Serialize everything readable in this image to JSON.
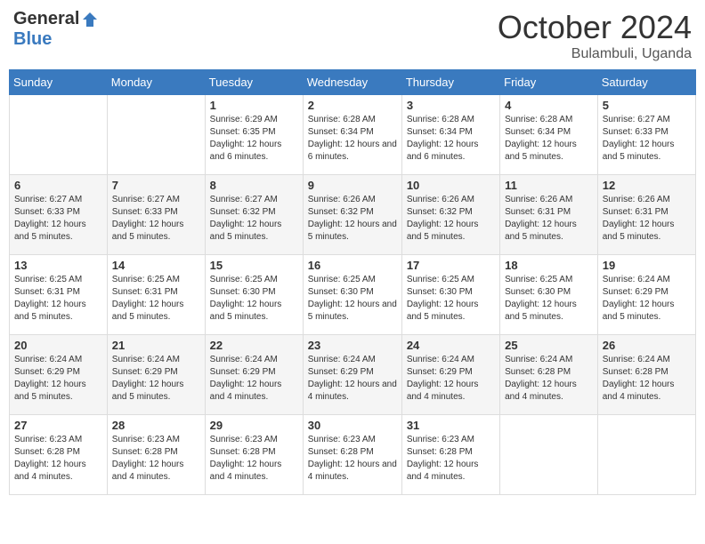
{
  "header": {
    "logo_general": "General",
    "logo_blue": "Blue",
    "month_title": "October 2024",
    "location": "Bulambuli, Uganda"
  },
  "days_of_week": [
    "Sunday",
    "Monday",
    "Tuesday",
    "Wednesday",
    "Thursday",
    "Friday",
    "Saturday"
  ],
  "weeks": [
    [
      {
        "day": "",
        "sunrise": "",
        "sunset": "",
        "daylight": ""
      },
      {
        "day": "",
        "sunrise": "",
        "sunset": "",
        "daylight": ""
      },
      {
        "day": "1",
        "sunrise": "Sunrise: 6:29 AM",
        "sunset": "Sunset: 6:35 PM",
        "daylight": "Daylight: 12 hours and 6 minutes."
      },
      {
        "day": "2",
        "sunrise": "Sunrise: 6:28 AM",
        "sunset": "Sunset: 6:34 PM",
        "daylight": "Daylight: 12 hours and 6 minutes."
      },
      {
        "day": "3",
        "sunrise": "Sunrise: 6:28 AM",
        "sunset": "Sunset: 6:34 PM",
        "daylight": "Daylight: 12 hours and 6 minutes."
      },
      {
        "day": "4",
        "sunrise": "Sunrise: 6:28 AM",
        "sunset": "Sunset: 6:34 PM",
        "daylight": "Daylight: 12 hours and 5 minutes."
      },
      {
        "day": "5",
        "sunrise": "Sunrise: 6:27 AM",
        "sunset": "Sunset: 6:33 PM",
        "daylight": "Daylight: 12 hours and 5 minutes."
      }
    ],
    [
      {
        "day": "6",
        "sunrise": "Sunrise: 6:27 AM",
        "sunset": "Sunset: 6:33 PM",
        "daylight": "Daylight: 12 hours and 5 minutes."
      },
      {
        "day": "7",
        "sunrise": "Sunrise: 6:27 AM",
        "sunset": "Sunset: 6:33 PM",
        "daylight": "Daylight: 12 hours and 5 minutes."
      },
      {
        "day": "8",
        "sunrise": "Sunrise: 6:27 AM",
        "sunset": "Sunset: 6:32 PM",
        "daylight": "Daylight: 12 hours and 5 minutes."
      },
      {
        "day": "9",
        "sunrise": "Sunrise: 6:26 AM",
        "sunset": "Sunset: 6:32 PM",
        "daylight": "Daylight: 12 hours and 5 minutes."
      },
      {
        "day": "10",
        "sunrise": "Sunrise: 6:26 AM",
        "sunset": "Sunset: 6:32 PM",
        "daylight": "Daylight: 12 hours and 5 minutes."
      },
      {
        "day": "11",
        "sunrise": "Sunrise: 6:26 AM",
        "sunset": "Sunset: 6:31 PM",
        "daylight": "Daylight: 12 hours and 5 minutes."
      },
      {
        "day": "12",
        "sunrise": "Sunrise: 6:26 AM",
        "sunset": "Sunset: 6:31 PM",
        "daylight": "Daylight: 12 hours and 5 minutes."
      }
    ],
    [
      {
        "day": "13",
        "sunrise": "Sunrise: 6:25 AM",
        "sunset": "Sunset: 6:31 PM",
        "daylight": "Daylight: 12 hours and 5 minutes."
      },
      {
        "day": "14",
        "sunrise": "Sunrise: 6:25 AM",
        "sunset": "Sunset: 6:31 PM",
        "daylight": "Daylight: 12 hours and 5 minutes."
      },
      {
        "day": "15",
        "sunrise": "Sunrise: 6:25 AM",
        "sunset": "Sunset: 6:30 PM",
        "daylight": "Daylight: 12 hours and 5 minutes."
      },
      {
        "day": "16",
        "sunrise": "Sunrise: 6:25 AM",
        "sunset": "Sunset: 6:30 PM",
        "daylight": "Daylight: 12 hours and 5 minutes."
      },
      {
        "day": "17",
        "sunrise": "Sunrise: 6:25 AM",
        "sunset": "Sunset: 6:30 PM",
        "daylight": "Daylight: 12 hours and 5 minutes."
      },
      {
        "day": "18",
        "sunrise": "Sunrise: 6:25 AM",
        "sunset": "Sunset: 6:30 PM",
        "daylight": "Daylight: 12 hours and 5 minutes."
      },
      {
        "day": "19",
        "sunrise": "Sunrise: 6:24 AM",
        "sunset": "Sunset: 6:29 PM",
        "daylight": "Daylight: 12 hours and 5 minutes."
      }
    ],
    [
      {
        "day": "20",
        "sunrise": "Sunrise: 6:24 AM",
        "sunset": "Sunset: 6:29 PM",
        "daylight": "Daylight: 12 hours and 5 minutes."
      },
      {
        "day": "21",
        "sunrise": "Sunrise: 6:24 AM",
        "sunset": "Sunset: 6:29 PM",
        "daylight": "Daylight: 12 hours and 5 minutes."
      },
      {
        "day": "22",
        "sunrise": "Sunrise: 6:24 AM",
        "sunset": "Sunset: 6:29 PM",
        "daylight": "Daylight: 12 hours and 4 minutes."
      },
      {
        "day": "23",
        "sunrise": "Sunrise: 6:24 AM",
        "sunset": "Sunset: 6:29 PM",
        "daylight": "Daylight: 12 hours and 4 minutes."
      },
      {
        "day": "24",
        "sunrise": "Sunrise: 6:24 AM",
        "sunset": "Sunset: 6:29 PM",
        "daylight": "Daylight: 12 hours and 4 minutes."
      },
      {
        "day": "25",
        "sunrise": "Sunrise: 6:24 AM",
        "sunset": "Sunset: 6:28 PM",
        "daylight": "Daylight: 12 hours and 4 minutes."
      },
      {
        "day": "26",
        "sunrise": "Sunrise: 6:24 AM",
        "sunset": "Sunset: 6:28 PM",
        "daylight": "Daylight: 12 hours and 4 minutes."
      }
    ],
    [
      {
        "day": "27",
        "sunrise": "Sunrise: 6:23 AM",
        "sunset": "Sunset: 6:28 PM",
        "daylight": "Daylight: 12 hours and 4 minutes."
      },
      {
        "day": "28",
        "sunrise": "Sunrise: 6:23 AM",
        "sunset": "Sunset: 6:28 PM",
        "daylight": "Daylight: 12 hours and 4 minutes."
      },
      {
        "day": "29",
        "sunrise": "Sunrise: 6:23 AM",
        "sunset": "Sunset: 6:28 PM",
        "daylight": "Daylight: 12 hours and 4 minutes."
      },
      {
        "day": "30",
        "sunrise": "Sunrise: 6:23 AM",
        "sunset": "Sunset: 6:28 PM",
        "daylight": "Daylight: 12 hours and 4 minutes."
      },
      {
        "day": "31",
        "sunrise": "Sunrise: 6:23 AM",
        "sunset": "Sunset: 6:28 PM",
        "daylight": "Daylight: 12 hours and 4 minutes."
      },
      {
        "day": "",
        "sunrise": "",
        "sunset": "",
        "daylight": ""
      },
      {
        "day": "",
        "sunrise": "",
        "sunset": "",
        "daylight": ""
      }
    ]
  ]
}
